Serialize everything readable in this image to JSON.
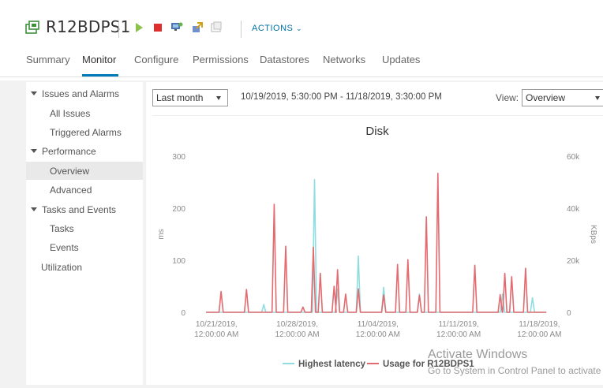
{
  "header": {
    "title": "R12BDPS1",
    "actions_label": "ACTIONS",
    "icons": [
      "vm-icon",
      "power-on-icon",
      "power-off-icon",
      "console-icon",
      "migrate-icon",
      "snapshot-icon"
    ],
    "colors": {
      "power_on": "#8bc34a",
      "power_off": "#e02d2d",
      "accent": "#0072a3"
    }
  },
  "tabs": [
    {
      "label": "Summary",
      "active": false
    },
    {
      "label": "Monitor",
      "active": true
    },
    {
      "label": "Configure",
      "active": false
    },
    {
      "label": "Permissions",
      "active": false
    },
    {
      "label": "Datastores",
      "active": false
    },
    {
      "label": "Networks",
      "active": false
    },
    {
      "label": "Updates",
      "active": false
    }
  ],
  "sidebar": {
    "groups": [
      {
        "label": "Issues and Alarms",
        "items": [
          "All Issues",
          "Triggered Alarms"
        ]
      },
      {
        "label": "Performance",
        "items": [
          "Overview",
          "Advanced"
        ]
      },
      {
        "label": "Tasks and Events",
        "items": [
          "Tasks",
          "Events"
        ]
      }
    ],
    "standalone": [
      "Utilization"
    ],
    "selected": "Overview"
  },
  "toolbar": {
    "period": "Last month",
    "range": "10/19/2019, 5:30:00 PM - 11/18/2019, 3:30:00 PM",
    "view_label": "View:",
    "view_value": "Overview"
  },
  "chart_data": {
    "type": "line",
    "title": "Disk",
    "ylabel": "ms",
    "y2label": "KBps",
    "ylim": [
      0,
      300
    ],
    "y2lim": [
      0,
      60000
    ],
    "yticks": [
      "0",
      "100",
      "200",
      "300"
    ],
    "y2ticks": [
      "0",
      "20k",
      "40k",
      "60k"
    ],
    "xlim": [
      -1.8,
      29.0
    ],
    "xticks": [
      {
        "x": 0,
        "line1": "10/21/2019,",
        "line2": "12:00:00 AM"
      },
      {
        "x": 7,
        "line1": "10/28/2019,",
        "line2": "12:00:00 AM"
      },
      {
        "x": 14,
        "line1": "11/04/2019,",
        "line2": "12:00:00 AM"
      },
      {
        "x": 21,
        "line1": "11/11/2019,",
        "line2": "12:00:00 AM"
      },
      {
        "x": 28,
        "line1": "11/18/2019,",
        "line2": "12:00:00 AM"
      }
    ],
    "grid": false,
    "legend_position": "bottom",
    "series": [
      {
        "name": "Highest latency",
        "axis": "left",
        "color": "#8fdde0",
        "spikes": [
          [
            4.1,
            15
          ],
          [
            8.5,
            255
          ],
          [
            10.5,
            45
          ],
          [
            12.3,
            108
          ],
          [
            14.5,
            48
          ],
          [
            17.6,
            35
          ],
          [
            24.8,
            35
          ],
          [
            27.4,
            28
          ]
        ]
      },
      {
        "name": "Usage for R12BDPS1",
        "axis": "right",
        "color": "#e46a70",
        "spikes": [
          [
            0.4,
            8000
          ],
          [
            2.6,
            8800
          ],
          [
            5.0,
            41500
          ],
          [
            6.0,
            25400
          ],
          [
            7.5,
            2000
          ],
          [
            8.4,
            25000
          ],
          [
            9.0,
            15000
          ],
          [
            10.2,
            10000
          ],
          [
            10.5,
            16400
          ],
          [
            11.2,
            7000
          ],
          [
            12.3,
            9000
          ],
          [
            14.5,
            6700
          ],
          [
            15.7,
            18400
          ],
          [
            16.6,
            20200
          ],
          [
            17.6,
            6500
          ],
          [
            18.2,
            36700
          ],
          [
            19.2,
            53400
          ],
          [
            22.4,
            18100
          ],
          [
            24.6,
            6800
          ],
          [
            25.0,
            15000
          ],
          [
            25.6,
            13700
          ],
          [
            26.8,
            16900
          ]
        ]
      }
    ]
  },
  "watermark": {
    "line1": "Activate Windows",
    "line2": "Go to System in Control Panel to activate"
  }
}
